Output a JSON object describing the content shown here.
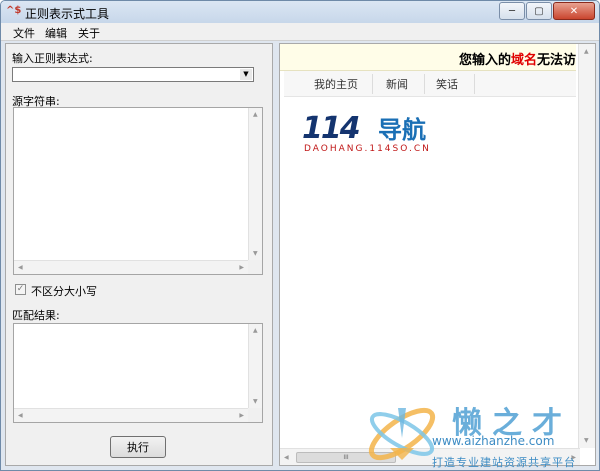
{
  "window": {
    "app_icon_text": "^$",
    "title": "正则表示式工具",
    "minimize_glyph": "─",
    "maximize_glyph": "▢",
    "close_glyph": "✕"
  },
  "menu": {
    "file": "文件",
    "edit": "编辑",
    "about": "关于"
  },
  "left": {
    "regex_label": "输入正则表达式:",
    "regex_value": "",
    "source_label": "源字符串:",
    "source_value": "",
    "case_label": "不区分大小写",
    "case_checked": true,
    "result_label": "匹配结果:",
    "result_value": "",
    "execute_label": "执行"
  },
  "browser": {
    "banner_prefix": "您输入的",
    "banner_highlight": "域名",
    "banner_suffix": "无法访",
    "nav": [
      "我的主页",
      "新闻",
      "笑话"
    ],
    "logo_number": "114",
    "logo_cn": "导航",
    "logo_sub": "DAOHANG.114SO.CN",
    "thumb_glyph": "III"
  },
  "watermark": {
    "title": "懒之才",
    "url": "www.aizhanzhe.com",
    "slogan": "打造专业建站资源共享平台"
  },
  "colors": {
    "banner_highlight": "#e00000",
    "logo_number": "#14346f",
    "logo_cn": "#1a6fb5",
    "logo_sub": "#c01818"
  }
}
